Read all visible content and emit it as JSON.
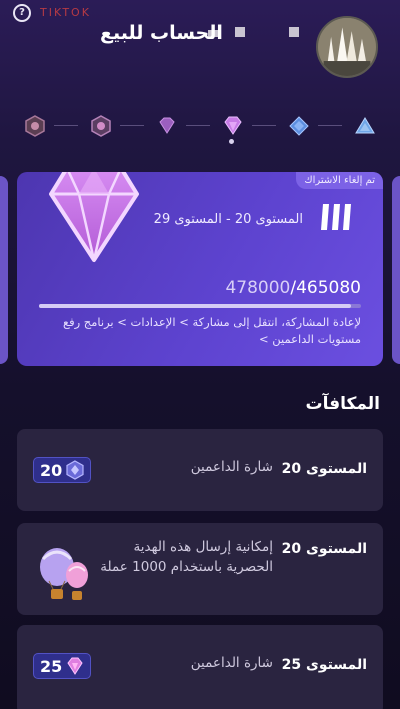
{
  "header": {
    "username": "الحساب للبيع",
    "ghost_title": "TIKTOK"
  },
  "level_track": {
    "icons": [
      "bronze-hexagon-icon",
      "silver-hexagon-icon",
      "purple-hexagon-icon",
      "small-diamond-icon",
      "violet-diamond-icon",
      "blue-diamond-icon",
      "triangle-icon"
    ]
  },
  "card": {
    "cancel_badge": "تم إلغاء الاشتراك",
    "level_range": "المستوى 20 - المستوى 29",
    "points_current": "465080",
    "points_total": "478000",
    "progress": 0.97,
    "description": "لإعادة المشاركة، انتقل إلى مشاركة > الإعدادات > برنامج رفع مستويات الداعمين >"
  },
  "rewards": {
    "title": "المكافآت",
    "items": [
      {
        "level": "المستوى 20",
        "text": "شارة الداعمين",
        "badge": "20"
      },
      {
        "level": "المستوى 20",
        "text": "إمكانية إرسال هذه الهدية الحصرية باستخدام 1000 عملة"
      },
      {
        "level": "المستوى 25",
        "text": "شارة الداعمين",
        "badge": "25"
      }
    ]
  },
  "colors": {
    "card_bg": "#5d43cf",
    "diamond": "#c97bea",
    "badge_bg": "#2f2f8c"
  }
}
